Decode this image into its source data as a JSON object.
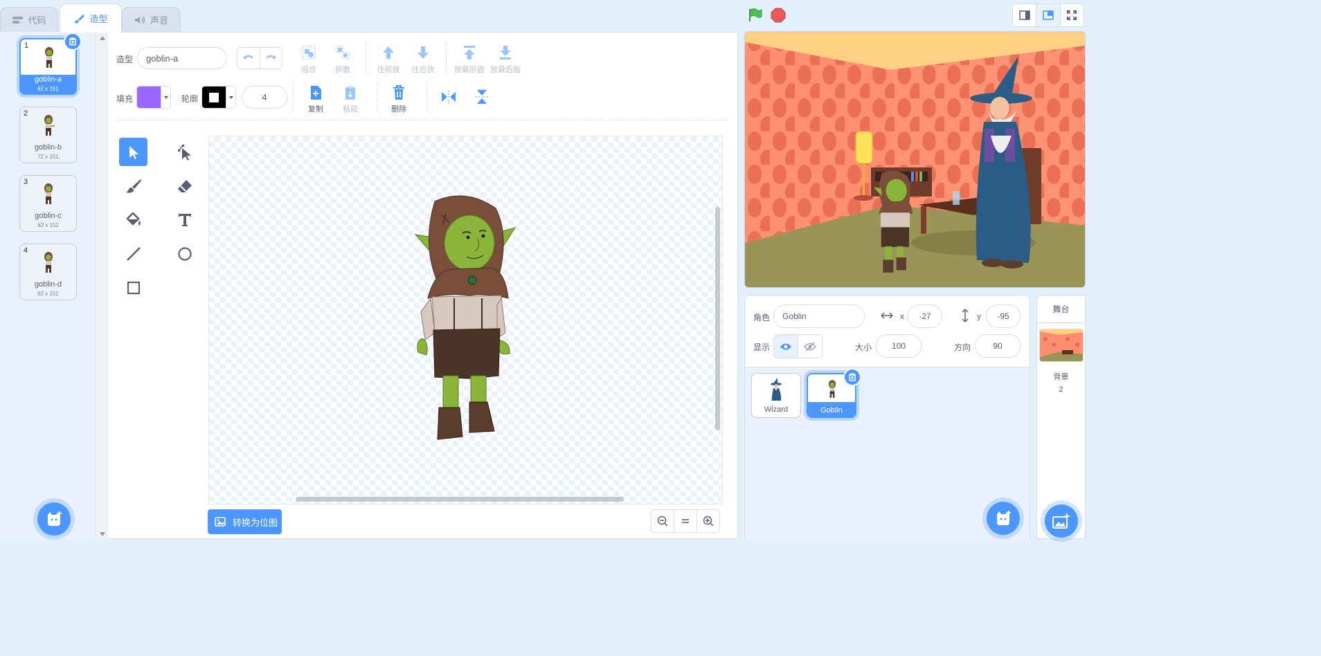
{
  "tabs": [
    {
      "label": "代码",
      "icon": "code-icon"
    },
    {
      "label": "造型",
      "icon": "brush-icon"
    },
    {
      "label": "声音",
      "icon": "speaker-icon"
    }
  ],
  "costumes": [
    {
      "num": "1",
      "name": "goblin-a",
      "size": "62 x 151"
    },
    {
      "num": "2",
      "name": "goblin-b",
      "size": "72 x 151"
    },
    {
      "num": "3",
      "name": "goblin-c",
      "size": "62 x 152"
    },
    {
      "num": "4",
      "name": "goblin-d",
      "size": "62 x 151"
    }
  ],
  "editor": {
    "costume_label": "造型",
    "costume_name": "goblin-a",
    "group": "组合",
    "ungroup": "拆散",
    "forward": "往前放",
    "backward": "往后放",
    "front": "放最前面",
    "back": "放最后面",
    "fill_label": "填充",
    "fill_color": "#9966ff",
    "outline_label": "轮廓",
    "outline_color": "#000000",
    "outline_width": "4",
    "copy": "复制",
    "paste": "粘贴",
    "delete": "删除",
    "convert_button": "转换为位图"
  },
  "sprite_info": {
    "sprite_label": "角色",
    "sprite_name": "Goblin",
    "x_label": "x",
    "x_value": "-27",
    "y_label": "y",
    "y_value": "-95",
    "show_label": "显示",
    "size_label": "大小",
    "size_value": "100",
    "direction_label": "方向",
    "direction_value": "90"
  },
  "sprites": [
    {
      "name": "Wizard"
    },
    {
      "name": "Goblin"
    }
  ],
  "stage_panel": {
    "title": "舞台",
    "backdrop_label": "背景",
    "backdrop_count": "2"
  },
  "colors": {
    "accent": "#4c97ff",
    "flag": "#4cbf56",
    "stop": "#ec5959"
  }
}
